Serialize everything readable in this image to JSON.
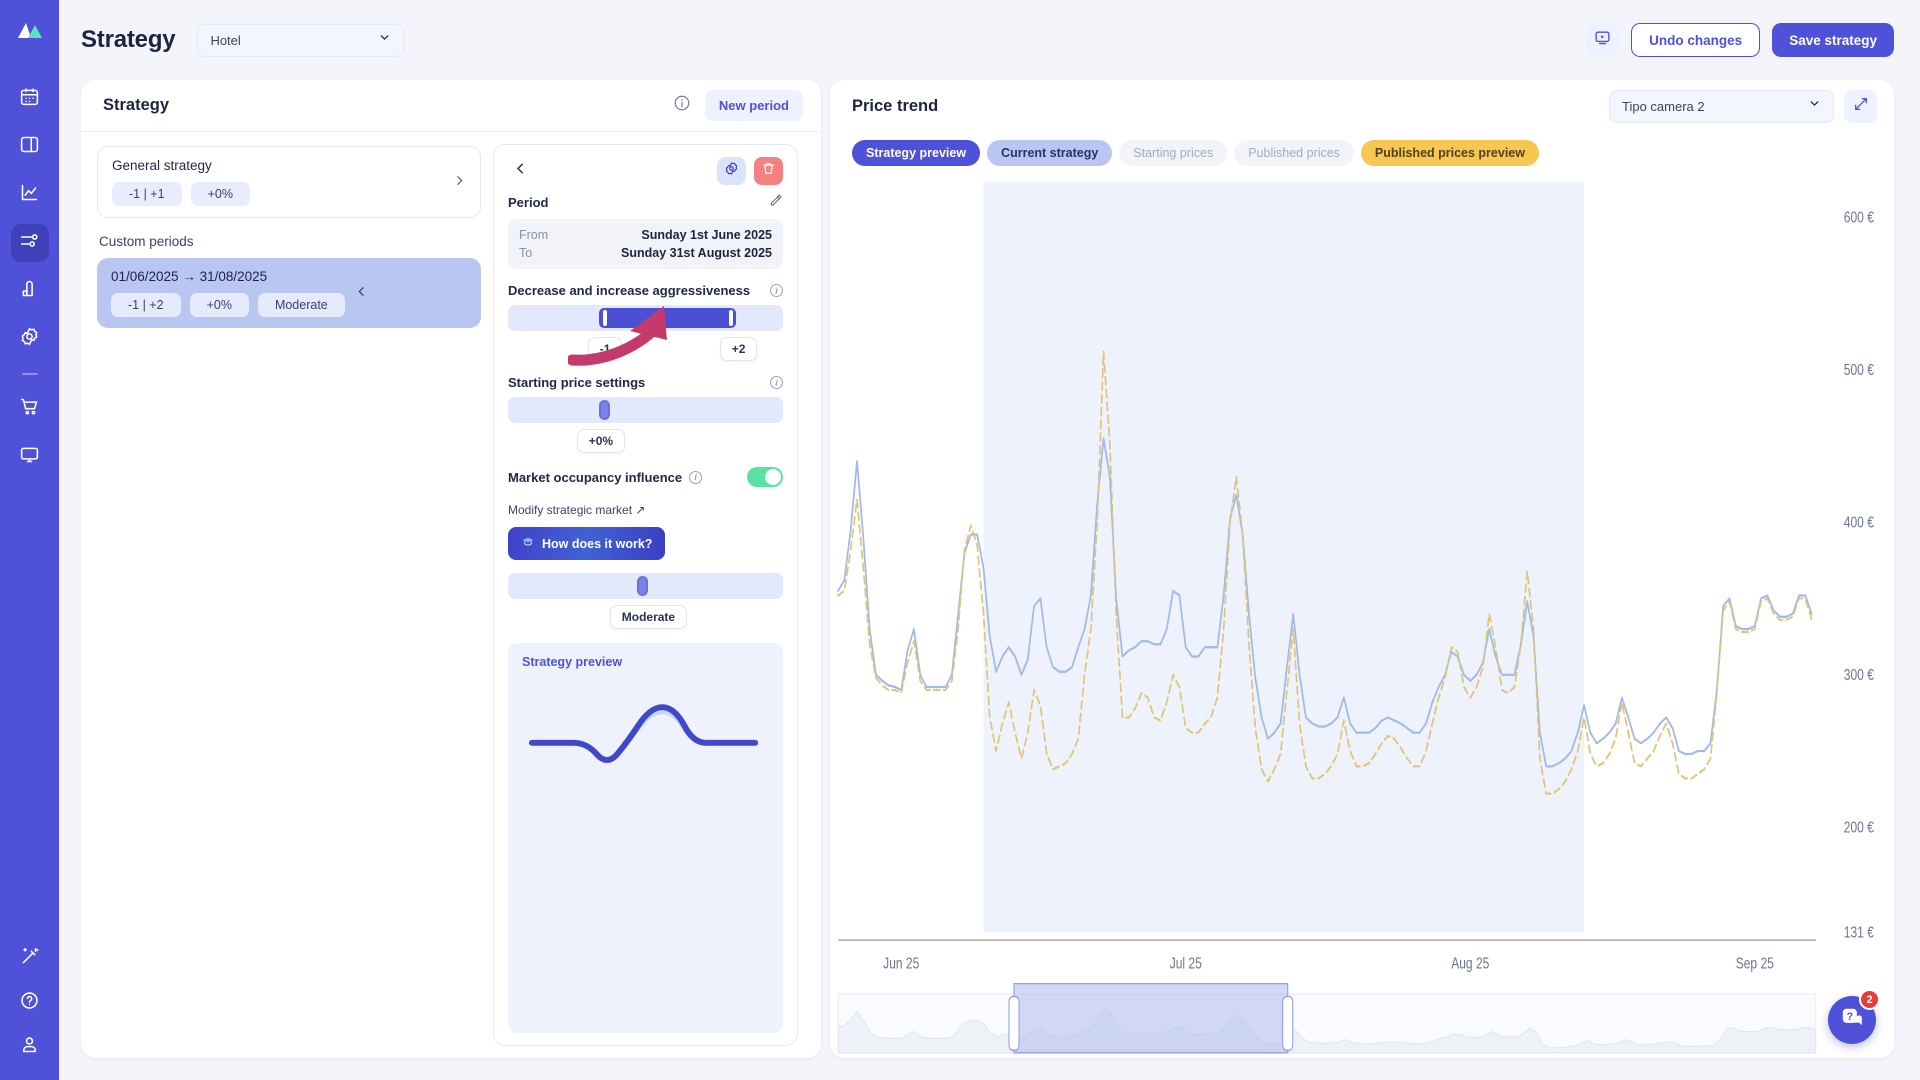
{
  "sidebar": {
    "logo_icon": "mountain-logo-icon",
    "items": [
      {
        "id": "calendar",
        "icon": "calendar-icon",
        "active": false
      },
      {
        "id": "dashboard",
        "icon": "layout-panel-icon",
        "active": false
      },
      {
        "id": "analytics",
        "icon": "line-chart-icon",
        "active": false
      },
      {
        "id": "strategy",
        "icon": "sliders-icon",
        "active": true
      },
      {
        "id": "reports",
        "icon": "bar-chart-icon",
        "active": false
      },
      {
        "id": "settings",
        "icon": "gear-icon",
        "active": false
      }
    ],
    "items_after_divider": [
      {
        "id": "shop",
        "icon": "cart-icon",
        "active": false
      },
      {
        "id": "channels",
        "icon": "monitor-icon",
        "active": false
      }
    ],
    "bottom_items": [
      {
        "id": "magic",
        "icon": "magic-wand-icon"
      },
      {
        "id": "help",
        "icon": "question-circle-icon"
      },
      {
        "id": "account",
        "icon": "user-icon"
      }
    ]
  },
  "topbar": {
    "title": "Strategy",
    "hotel_select": {
      "value": "Hotel",
      "chevron": "chevron-down-icon"
    },
    "video_icon": "video-tutorial-icon",
    "undo_label": "Undo changes",
    "save_label": "Save strategy"
  },
  "strategy_panel": {
    "header": "Strategy",
    "info_icon": "info-icon",
    "new_period_label": "New period",
    "general": {
      "title": "General strategy",
      "chips": [
        "-1 | +1",
        "+0%"
      ],
      "chevron": "chevron-right-icon"
    },
    "custom_periods_label": "Custom periods",
    "periods": [
      {
        "title": "01/06/2025 → 31/08/2025",
        "chips": [
          "-1 | +2",
          "+0%",
          "Moderate"
        ],
        "chevron": "chevron-left-icon",
        "selected": true
      }
    ]
  },
  "detail": {
    "back_icon": "chevron-left-icon",
    "gear_icon": "gear-icon",
    "trash_icon": "trash-icon",
    "period": {
      "label": "Period",
      "edit_icon": "pencil-icon",
      "from_label": "From",
      "from_value": "Sunday 1st June 2025",
      "to_label": "To",
      "to_value": "Sunday 31st August 2025"
    },
    "aggressiveness": {
      "label": "Decrease and increase aggressiveness",
      "info_icon": "info-icon",
      "min_value": "-1",
      "max_value": "+2"
    },
    "starting_price": {
      "label": "Starting price settings",
      "info_icon": "info-icon",
      "value": "+0%"
    },
    "market_occupancy": {
      "label": "Market occupancy influence",
      "info_icon": "info-icon",
      "toggle_on": true,
      "modify_link": "Modify strategic market ↗",
      "how_button": "How does it work?",
      "how_icon": "graduation-cap-icon",
      "slider_value": "Moderate"
    },
    "preview": {
      "title": "Strategy preview"
    }
  },
  "chart_panel": {
    "title": "Price trend",
    "room_select": {
      "value": "Tipo camera 2",
      "chevron": "chevron-down-icon"
    },
    "expand_icon": "expand-diagonal-icon",
    "tabs": [
      {
        "label": "Strategy preview",
        "state": "active"
      },
      {
        "label": "Current strategy",
        "state": "blue"
      },
      {
        "label": "Starting prices",
        "state": "grey"
      },
      {
        "label": "Published prices",
        "state": "grey"
      },
      {
        "label": "Published prices preview",
        "state": "yellow"
      }
    ]
  },
  "help": {
    "icon": "chat-question-icon",
    "badge": "2"
  },
  "colors": {
    "brand": "#4f51d8",
    "accent_blue": "#b9c6f2",
    "accent_yellow": "#f7c752",
    "toggle_on": "#5ae3a0",
    "danger": "#f58080",
    "series_blue": "#9fb9e8",
    "series_yellow": "#e0c478",
    "highlight_band": "#eef2fd",
    "arrow": "#c43a6b"
  },
  "chart_data": {
    "type": "line",
    "title": "Price trend",
    "xlabel": "",
    "ylabel": "",
    "ylim": [
      131,
      620
    ],
    "yticks": [
      131,
      200,
      300,
      400,
      500,
      600
    ],
    "ytick_labels": [
      "131 €",
      "200 €",
      "300 €",
      "400 €",
      "500 €",
      "600 €"
    ],
    "xticks": [
      10,
      55,
      100,
      145
    ],
    "xtick_labels": [
      "Jun 25",
      "Jul 25",
      "Aug 25",
      "Sep 25"
    ],
    "grid": false,
    "legend_position": "none",
    "highlight_band": {
      "from": 23,
      "to": 118,
      "label": "01/06/2025 → 31/08/2025"
    },
    "series": [
      {
        "name": "Strategy preview",
        "color": "#9fb9e8",
        "style": "solid",
        "values": [
          355,
          362,
          395,
          440,
          390,
          330,
          300,
          296,
          293,
          292,
          290,
          316,
          330,
          300,
          292,
          292,
          292,
          292,
          300,
          340,
          380,
          392,
          392,
          370,
          325,
          302,
          312,
          318,
          312,
          300,
          310,
          345,
          350,
          318,
          305,
          302,
          302,
          305,
          318,
          330,
          352,
          412,
          455,
          430,
          350,
          312,
          316,
          318,
          322,
          322,
          320,
          320,
          330,
          355,
          352,
          318,
          312,
          312,
          318,
          318,
          318,
          352,
          402,
          418,
          392,
          340,
          298,
          272,
          258,
          262,
          268,
          305,
          340,
          300,
          272,
          268,
          266,
          266,
          268,
          272,
          285,
          268,
          262,
          262,
          262,
          265,
          270,
          272,
          270,
          268,
          265,
          262,
          262,
          268,
          282,
          292,
          300,
          315,
          312,
          300,
          296,
          300,
          308,
          330,
          312,
          300,
          300,
          300,
          320,
          348,
          325,
          262,
          240,
          240,
          242,
          245,
          250,
          262,
          280,
          262,
          255,
          258,
          262,
          268,
          285,
          272,
          258,
          255,
          258,
          262,
          268,
          272,
          265,
          250,
          248,
          248,
          250,
          250,
          255,
          290,
          345,
          350,
          332,
          330,
          330,
          332,
          350,
          352,
          342,
          338,
          338,
          340,
          352,
          352,
          340
        ]
      },
      {
        "name": "Published prices preview",
        "color": "#e0c478",
        "style": "dashed",
        "values": [
          352,
          355,
          382,
          415,
          370,
          320,
          298,
          293,
          290,
          290,
          288,
          308,
          322,
          296,
          290,
          290,
          290,
          290,
          296,
          330,
          382,
          398,
          385,
          340,
          272,
          250,
          268,
          282,
          262,
          245,
          262,
          290,
          280,
          248,
          238,
          240,
          242,
          248,
          258,
          300,
          330,
          400,
          512,
          452,
          340,
          272,
          272,
          278,
          288,
          285,
          272,
          270,
          282,
          300,
          292,
          265,
          262,
          262,
          268,
          272,
          285,
          330,
          400,
          430,
          392,
          320,
          265,
          238,
          230,
          238,
          248,
          290,
          330,
          268,
          240,
          232,
          232,
          235,
          240,
          248,
          270,
          250,
          240,
          240,
          242,
          248,
          255,
          260,
          258,
          252,
          245,
          240,
          240,
          250,
          268,
          285,
          298,
          318,
          315,
          292,
          285,
          292,
          305,
          340,
          318,
          290,
          288,
          292,
          320,
          368,
          330,
          245,
          222,
          222,
          225,
          230,
          238,
          250,
          272,
          248,
          240,
          242,
          248,
          258,
          282,
          262,
          242,
          240,
          245,
          250,
          260,
          268,
          255,
          235,
          232,
          232,
          235,
          238,
          245,
          288,
          342,
          348,
          330,
          328,
          328,
          330,
          348,
          350,
          340,
          336,
          336,
          338,
          350,
          350,
          336
        ]
      }
    ],
    "brush": {
      "selected_from": 0.18,
      "selected_to": 0.46
    }
  }
}
